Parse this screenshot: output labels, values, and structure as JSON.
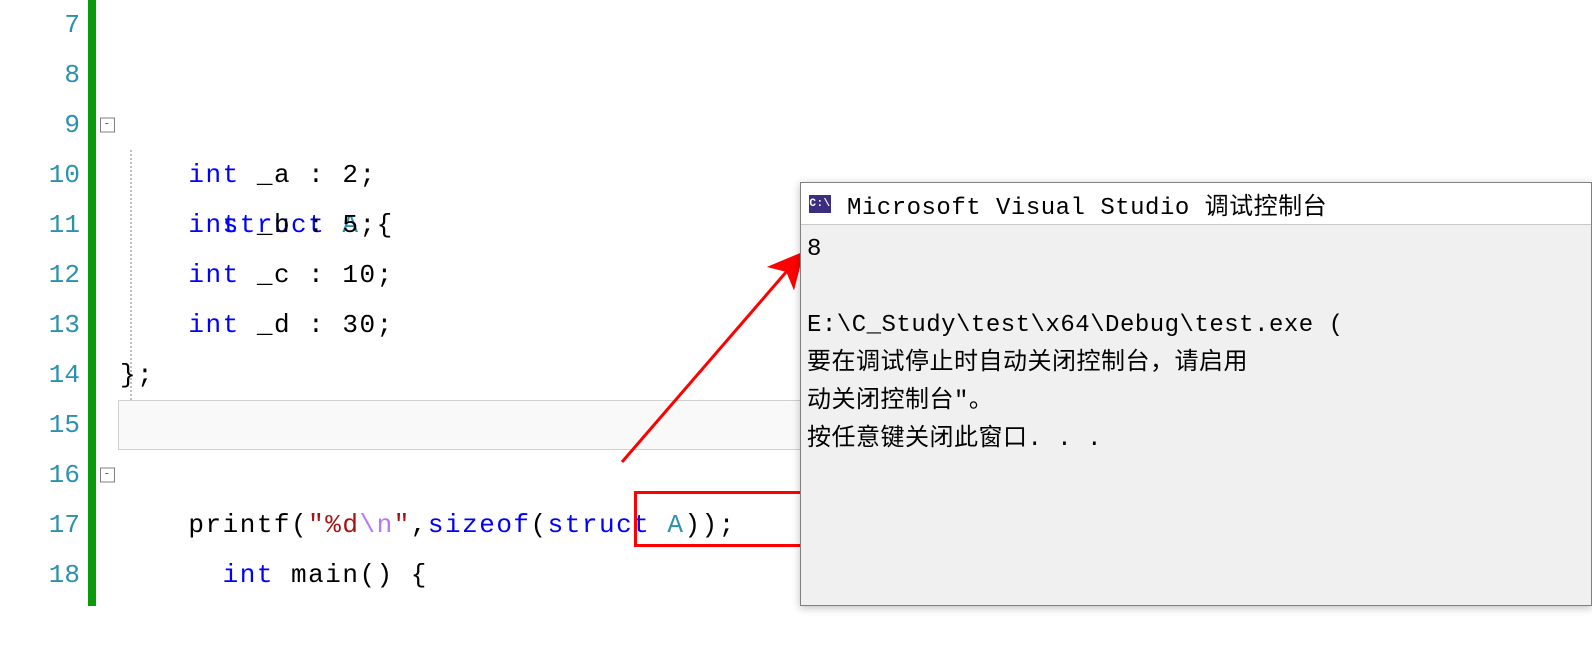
{
  "editor": {
    "line_numbers": [
      "7",
      "8",
      "9",
      "10",
      "11",
      "12",
      "13",
      "14",
      "15",
      "16",
      "17",
      "18"
    ],
    "fold_marker": "-",
    "tokens": {
      "struct": "struct",
      "A": "A",
      "lbrace": "{",
      "rbrace_sc": "};",
      "int": "int",
      "_a": "_a",
      "_b": "_b",
      "_c": "_c",
      "_d": "_d",
      "colon": ":",
      "v2": "2",
      "v5": "5",
      "v10": "10",
      "v30": "30",
      "sc": ";",
      "main": "main",
      "parens": "()",
      "printf": "printf",
      "lpar": "(",
      "rpar": ")",
      "format_q1": "\"",
      "format_pd": "%d",
      "format_esc": "\\n",
      "format_q2": "\"",
      "comma": ",",
      "sizeof": "sizeof",
      "struct2": "struct",
      "A2": "A",
      "tail": ");"
    }
  },
  "console": {
    "icon_text": "C:\\",
    "title": "Microsoft Visual Studio 调试控制台",
    "body": "8\n\nE:\\C_Study\\test\\x64\\Debug\\test.exe (\n要在调试停止时自动关闭控制台，请启用\n动关闭控制台\"。\n按任意键关闭此窗口. . ."
  }
}
